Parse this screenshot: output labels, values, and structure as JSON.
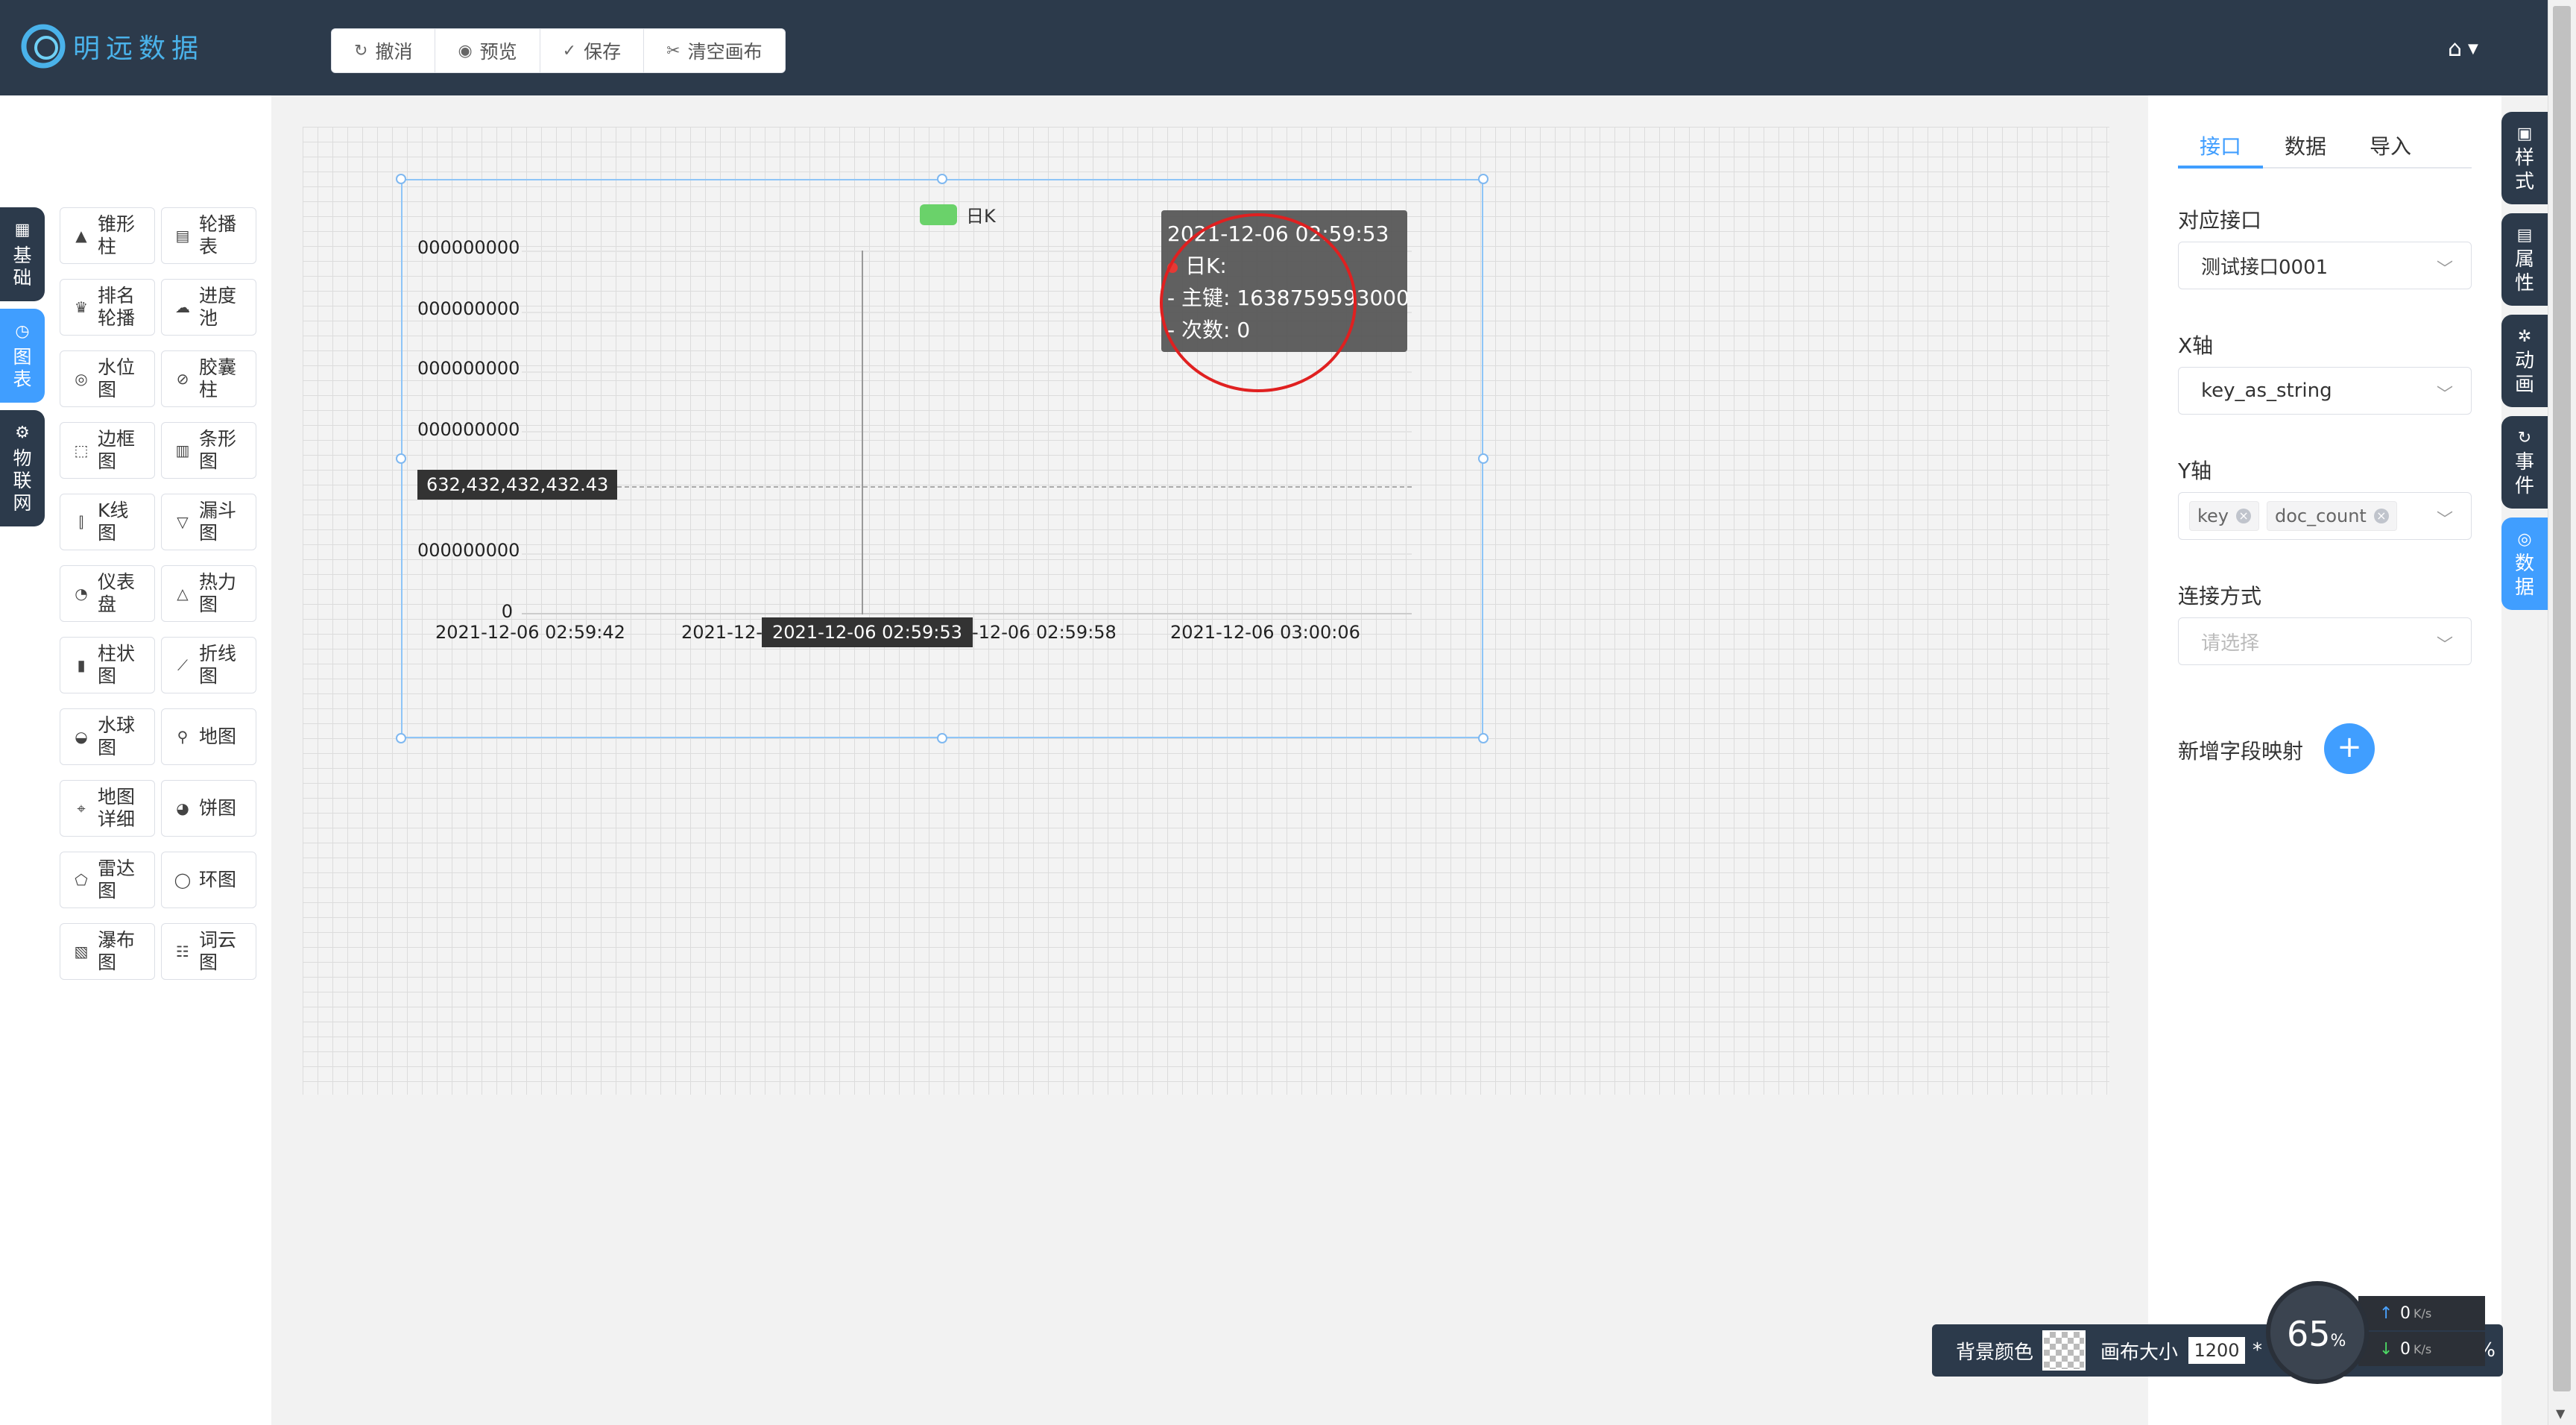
{
  "app": {
    "logo_text": "明远数据"
  },
  "toolbar": {
    "undo": "撤消",
    "preview": "预览",
    "save": "保存",
    "clear": "清空画布"
  },
  "side_tabs": [
    {
      "icon": "grid-icon",
      "label": "基础"
    },
    {
      "icon": "chart-icon",
      "label": "图表"
    },
    {
      "icon": "iot-icon",
      "label": "物联网"
    }
  ],
  "components": [
    {
      "icon": "cone-column-icon",
      "label": "锥形柱"
    },
    {
      "icon": "carousel-table-icon",
      "label": "轮播表"
    },
    {
      "icon": "ranking-icon",
      "label": "排名轮播"
    },
    {
      "icon": "progress-pool-icon",
      "label": "进度池"
    },
    {
      "icon": "water-level-icon",
      "label": "水位图"
    },
    {
      "icon": "capsule-icon",
      "label": "胶囊柱"
    },
    {
      "icon": "border-icon",
      "label": "边框图"
    },
    {
      "icon": "bar-icon",
      "label": "条形图"
    },
    {
      "icon": "kline-icon",
      "label": "K线图"
    },
    {
      "icon": "funnel-icon",
      "label": "漏斗图"
    },
    {
      "icon": "gauge-icon",
      "label": "仪表盘"
    },
    {
      "icon": "heatmap-icon",
      "label": "热力图"
    },
    {
      "icon": "column-icon",
      "label": "柱状图"
    },
    {
      "icon": "line-chart-icon",
      "label": "折线图"
    },
    {
      "icon": "liquid-ball-icon",
      "label": "水球图"
    },
    {
      "icon": "map-pin-icon",
      "label": "地图"
    },
    {
      "icon": "map-detail-icon",
      "label": "地图详细"
    },
    {
      "icon": "pie-icon",
      "label": "饼图"
    },
    {
      "icon": "radar-icon",
      "label": "雷达图"
    },
    {
      "icon": "ring-icon",
      "label": "环图"
    },
    {
      "icon": "waterfall-icon",
      "label": "瀑布图"
    },
    {
      "icon": "word-cloud-icon",
      "label": "词云图"
    }
  ],
  "chart_data": {
    "type": "line",
    "legend": [
      "日K"
    ],
    "series_color": "#6ad26a",
    "y_tick_labels": [
      "000000000",
      "000000000",
      "000000000",
      "000000000",
      "000000000",
      "0"
    ],
    "x_tick_labels": [
      "2021-12-06 02:59:42",
      "2021-12-",
      "-12-06 02:59:58",
      "2021-12-06 03:00:06"
    ],
    "axis_pointer": {
      "x_label": "2021-12-06 02:59:53",
      "y_label": "632,432,432,432.43"
    },
    "tooltip": {
      "title": "2021-12-06 02:59:53",
      "series": "日K:",
      "lines": [
        "- 主键: 1638759593000",
        "- 次数: 0"
      ]
    }
  },
  "right_panel": {
    "tabs": [
      "接口",
      "数据",
      "导入"
    ],
    "active_tab": "接口",
    "interface_label": "对应接口",
    "interface_value": "测试接口0001",
    "x_axis_label": "X轴",
    "x_axis_value": "key_as_string",
    "y_axis_label": "Y轴",
    "y_axis_tags": [
      "key",
      "doc_count"
    ],
    "connect_label": "连接方式",
    "connect_placeholder": "请选择",
    "add_mapping_label": "新增字段映射"
  },
  "edge_tabs": [
    {
      "icon": "style-icon",
      "label": "样式"
    },
    {
      "icon": "property-icon",
      "label": "属性"
    },
    {
      "icon": "animation-icon",
      "label": "动画"
    },
    {
      "icon": "event-icon",
      "label": "事件"
    },
    {
      "icon": "data-icon",
      "label": "数据"
    }
  ],
  "bottom_bar": {
    "bg_color_label": "背景颜色",
    "canvas_size_label": "画布大小",
    "canvas_width": "1200",
    "times": "*",
    "percent_sign": "%"
  },
  "net_widget": {
    "gauge_value": "65",
    "gauge_unit": "%",
    "up_value": "0",
    "down_value": "0",
    "speed_unit": "K/s"
  },
  "colors": {
    "header": "#2c3a4b",
    "accent": "#409eff",
    "logo": "#4ab2ea",
    "annotation": "#e02020"
  }
}
